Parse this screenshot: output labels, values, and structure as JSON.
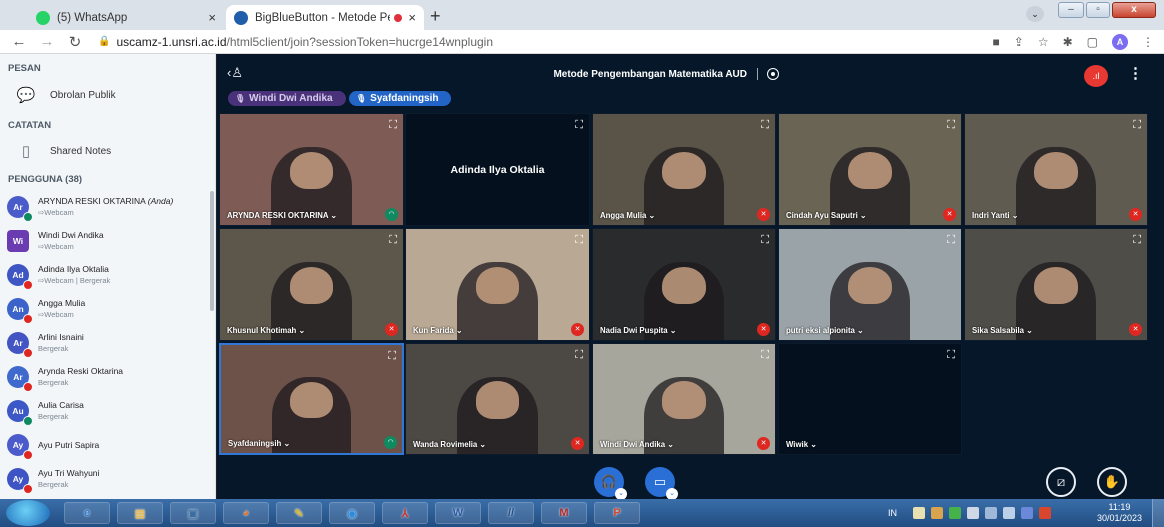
{
  "browser": {
    "tabs": [
      {
        "title": "(5) WhatsApp",
        "close": "×",
        "favicon_color": "#25d366"
      },
      {
        "title": "BigBlueButton - Metode Pen",
        "close": "×",
        "favicon_color": "#1f5ea8"
      }
    ],
    "new_tab": "+",
    "url_host": "uscamz-1.unsri.ac.id",
    "url_path": "/html5client/join?sessionToken=hucrge14wnplugin",
    "profile_initial": "A"
  },
  "sidebar": {
    "messages_header": "PESAN",
    "public_chat": "Obrolan Publik",
    "notes_header": "CATATAN",
    "shared_notes": "Shared Notes",
    "users_header": "PENGGUNA (38)",
    "users": [
      {
        "initials": "Ar",
        "name": "ARYNDA RESKI OKTARINA",
        "you": "(Anda)",
        "status": "⇨Webcam",
        "badge": "green",
        "color": "#4a5cc9",
        "square": false
      },
      {
        "initials": "Wi",
        "name": "Windi Dwi Andika",
        "you": "",
        "status": "⇨Webcam",
        "badge": "",
        "color": "#6a3bb1",
        "square": true
      },
      {
        "initials": "Ad",
        "name": "Adinda Ilya Oktalia",
        "you": "",
        "status": "⇨Webcam | Bergerak",
        "badge": "red",
        "color": "#3e55c4",
        "square": false
      },
      {
        "initials": "An",
        "name": "Angga Mulia",
        "you": "",
        "status": "⇨Webcam",
        "badge": "red",
        "color": "#3b63c9",
        "square": false
      },
      {
        "initials": "Ar",
        "name": "Arlini Isnaini",
        "you": "",
        "status": "Bergerak",
        "badge": "red",
        "color": "#4255c3",
        "square": false
      },
      {
        "initials": "Ar",
        "name": "Arynda Reski Oktarina",
        "you": "",
        "status": "Bergerak",
        "badge": "red",
        "color": "#3f69cd",
        "square": false
      },
      {
        "initials": "Au",
        "name": "Aulia Carisa",
        "you": "",
        "status": "Bergerak",
        "badge": "green",
        "color": "#3c57c6",
        "square": false
      },
      {
        "initials": "Ay",
        "name": "Ayu Putri Sapira",
        "you": "",
        "status": "",
        "badge": "red",
        "color": "#4b5bcb",
        "square": false
      },
      {
        "initials": "Ay",
        "name": "Ayu Tri Wahyuni",
        "you": "",
        "status": "Bergerak",
        "badge": "red",
        "color": "#3f54c4",
        "square": false
      }
    ]
  },
  "main": {
    "meeting_title": "Metode Pengembangan Matematika AUD",
    "talkers": [
      "Windi Dwi Andika",
      "Syafdaningsih"
    ],
    "videos": [
      {
        "name": "ARYNDA RESKI OKTARINA ⌄",
        "mic": "green",
        "bg": "#7e5b55"
      },
      {
        "name": "",
        "mic": "",
        "bg": "#04101d",
        "placeholder": "Adinda Ilya Oktalia"
      },
      {
        "name": "Angga Mulia ⌄",
        "mic": "red",
        "bg": "#5a5448"
      },
      {
        "name": "Cindah Ayu Saputri ⌄",
        "mic": "red",
        "bg": "#6a6454"
      },
      {
        "name": "Indri Yanti ⌄",
        "mic": "red",
        "bg": "#5f5b50"
      },
      {
        "name": "Khusnul Khotimah ⌄",
        "mic": "red",
        "bg": "#5d564a"
      },
      {
        "name": "Kun Farida ⌄",
        "mic": "red",
        "bg": "#b9a894"
      },
      {
        "name": "Nadia Dwi Puspita ⌄",
        "mic": "red",
        "bg": "#2a2b2d"
      },
      {
        "name": "putri eksi alpionita ⌄",
        "mic": "",
        "bg": "#9aa3a8"
      },
      {
        "name": "Sika Salsabila ⌄",
        "mic": "red",
        "bg": "#4e4d48"
      },
      {
        "name": "Syafdaningsih ⌄",
        "mic": "green",
        "bg": "#6d5249"
      },
      {
        "name": "Wanda Rovimelia ⌄",
        "mic": "red",
        "bg": "#4c4843"
      },
      {
        "name": "Windi Dwi Andika ⌄",
        "mic": "red",
        "bg": "#a7a69c"
      },
      {
        "name": "Wiwik ⌄",
        "mic": "",
        "bg": "#04101d"
      }
    ]
  },
  "taskbar": {
    "apps": [
      "e",
      "▤",
      "▣",
      "◕",
      "✎",
      "◉",
      "⅄",
      "W",
      "//",
      "M",
      "P"
    ],
    "lang": "IN",
    "time": "11:19",
    "date": "30/01/2023"
  },
  "colors": {
    "primary": "#2a6fd6",
    "danger": "#df2721",
    "success": "#0f8a60",
    "meeting_bg": "#06172a"
  }
}
